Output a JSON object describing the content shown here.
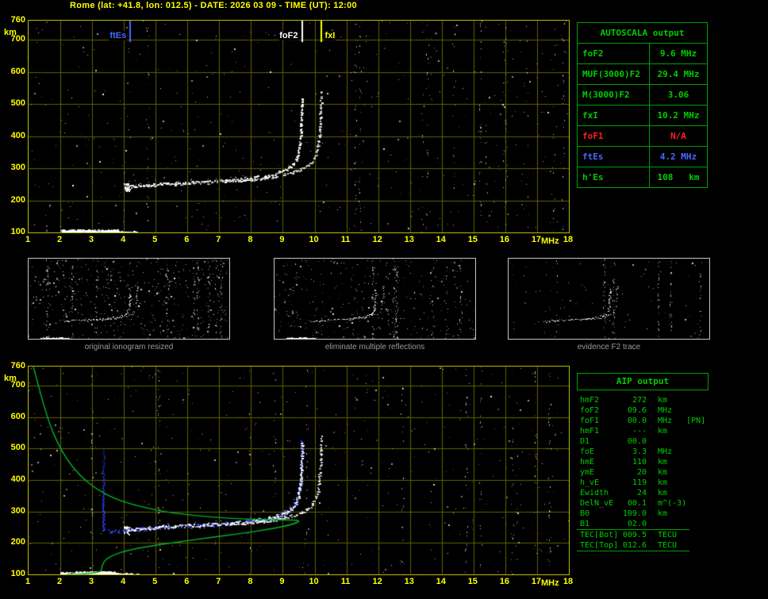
{
  "title": "Rome (lat: +41.8, lon: 012.5) - DATE: 2026 03 09 - TIME (UT): 12:00",
  "colors": {
    "axis": "#ffff00",
    "grid": "#616100",
    "plot_border": "#b9b900",
    "green_text": "#00cc00",
    "table_border": "#00a000",
    "red": "#ff2020",
    "blue": "#4868ff",
    "profile_green": "#00b428",
    "trace_blue": "#2e46ff",
    "caption_gray": "#9a9a9a"
  },
  "ionogram_axes": {
    "x_label": "MHz",
    "y_label": "km",
    "x_min": 1,
    "x_max": 18,
    "y_min": 100,
    "y_max": 760,
    "x_ticks": [
      1,
      2,
      3,
      4,
      5,
      6,
      7,
      8,
      9,
      10,
      11,
      12,
      13,
      14,
      15,
      16,
      17,
      18
    ],
    "y_ticks": [
      760,
      700,
      600,
      500,
      400,
      300,
      200,
      100
    ]
  },
  "top_plot_markers": [
    {
      "label": "ftEs",
      "freq": 4.2,
      "color": "#4868ff",
      "side": "left"
    },
    {
      "label": "foF2",
      "freq": 9.6,
      "color": "#ffffff",
      "side": "left"
    },
    {
      "label": "fxI",
      "freq": 10.2,
      "color": "#ffff00",
      "side": "right"
    }
  ],
  "autoscala_table": {
    "title": "AUTOSCALA output",
    "rows": [
      {
        "param": "foF2",
        "value": "9.6 MHz",
        "color": "green"
      },
      {
        "param": "MUF(3000)F2",
        "value": "29.4 MHz",
        "color": "green"
      },
      {
        "param": "M(3000)F2",
        "value": "3.06",
        "color": "green"
      },
      {
        "param": "fxI",
        "value": "10.2 MHz",
        "color": "green"
      },
      {
        "param": "foF1",
        "value": "N/A",
        "color": "red"
      },
      {
        "param": "ftEs",
        "value": "4.2 MHz",
        "color": "blue"
      },
      {
        "param": "h'Es",
        "value": "108   km",
        "color": "green"
      }
    ]
  },
  "thumbnails": [
    {
      "caption": "original ionogram resized"
    },
    {
      "caption": "eliminate multiple reflections"
    },
    {
      "caption": "evidence F2 trace"
    }
  ],
  "aip_table": {
    "title": "AIP output",
    "rows": [
      {
        "param": "hmF2",
        "value": "272",
        "unit": "km"
      },
      {
        "param": "foF2",
        "value": "09.6",
        "unit": "MHz"
      },
      {
        "param": "foF1",
        "value": "00.0",
        "unit": "MHz   [PN]"
      },
      {
        "param": "hmF1",
        "value": "---",
        "unit": "km"
      },
      {
        "param": "D1",
        "value": "00.0",
        "unit": ""
      },
      {
        "param": "foE",
        "value": "3.3",
        "unit": "MHz"
      },
      {
        "param": "hmE",
        "value": "110",
        "unit": "km"
      },
      {
        "param": "ymE",
        "value": "20",
        "unit": "km"
      },
      {
        "param": "h_vE",
        "value": "119",
        "unit": "km"
      },
      {
        "param": "Ewidth",
        "value": "24",
        "unit": "km"
      },
      {
        "param": "DelN_vE",
        "value": "00.1",
        "unit": "m^(-3)"
      },
      {
        "param": "B0",
        "value": "109.0",
        "unit": "km"
      },
      {
        "param": "B1",
        "value": "02.0",
        "unit": ""
      },
      {
        "param": "TEC[Bot]",
        "value": "009.5",
        "unit": "TECU",
        "section": "tec"
      },
      {
        "param": "TEC[Top]",
        "value": "012.6",
        "unit": "TECU",
        "section": "tec"
      }
    ]
  },
  "chart_data": [
    {
      "type": "scatter",
      "name": "scaled ionogram (top panel)",
      "xlabel": "MHz",
      "ylabel": "km",
      "xlim": [
        1,
        18
      ],
      "ylim": [
        100,
        760
      ],
      "foF2_MHz": 9.6,
      "fxI_MHz": 10.2,
      "ftEs_MHz": 4.2,
      "hEs_km": 108,
      "es_layer": {
        "f_range": [
          2.0,
          3.8
        ],
        "h_mean": 104,
        "h_spread": 6
      },
      "es_tail": {
        "f_range": [
          3.8,
          4.45
        ],
        "h_mean": 101,
        "h_spread": 2.5
      },
      "cusp": {
        "f_range": [
          3.98,
          4.18
        ],
        "h_range": [
          228,
          254
        ]
      },
      "o_trace": [
        [
          4.05,
          240
        ],
        [
          4.3,
          244
        ],
        [
          4.7,
          247
        ],
        [
          5.1,
          250
        ],
        [
          5.5,
          252
        ],
        [
          6.0,
          255
        ],
        [
          6.5,
          257
        ],
        [
          7.0,
          260
        ],
        [
          7.5,
          263
        ],
        [
          8.0,
          268
        ],
        [
          8.4,
          274
        ],
        [
          8.8,
          283
        ],
        [
          9.1,
          295
        ],
        [
          9.3,
          310
        ],
        [
          9.42,
          330
        ],
        [
          9.5,
          358
        ],
        [
          9.55,
          395
        ],
        [
          9.58,
          440
        ],
        [
          9.6,
          520
        ]
      ],
      "x_trace": [
        [
          7.2,
          259
        ],
        [
          7.7,
          262
        ],
        [
          8.2,
          266
        ],
        [
          8.7,
          272
        ],
        [
          9.1,
          280
        ],
        [
          9.4,
          290
        ],
        [
          9.7,
          302
        ],
        [
          9.9,
          318
        ],
        [
          10.02,
          340
        ],
        [
          10.1,
          368
        ],
        [
          10.15,
          405
        ],
        [
          10.18,
          455
        ],
        [
          10.2,
          540
        ]
      ]
    },
    {
      "type": "line",
      "name": "restored electron density profile (bottom panel)",
      "profile_green": [
        [
          1.15,
          760
        ],
        [
          1.4,
          665
        ],
        [
          1.65,
          580
        ],
        [
          1.9,
          520
        ],
        [
          2.2,
          465
        ],
        [
          2.6,
          415
        ],
        [
          3.1,
          373
        ],
        [
          3.7,
          340
        ],
        [
          4.5,
          315
        ],
        [
          5.5,
          295
        ],
        [
          6.8,
          281
        ],
        [
          8.0,
          275
        ],
        [
          9.0,
          273
        ],
        [
          9.6,
          272
        ],
        [
          9.3,
          258
        ],
        [
          8.6,
          244
        ],
        [
          7.7,
          230
        ],
        [
          6.7,
          217
        ],
        [
          5.7,
          203
        ],
        [
          4.8,
          190
        ],
        [
          4.1,
          176
        ],
        [
          3.7,
          163
        ],
        [
          3.45,
          150
        ],
        [
          3.35,
          136
        ],
        [
          3.3,
          122
        ],
        [
          3.3,
          112
        ],
        [
          3.2,
          107
        ],
        [
          2.9,
          103
        ],
        [
          2.5,
          100
        ],
        [
          2.2,
          100
        ]
      ],
      "restored_trace_blue": [
        [
          3.5,
          238
        ],
        [
          3.8,
          236
        ],
        [
          4.2,
          240
        ],
        [
          4.7,
          245
        ],
        [
          5.2,
          249
        ],
        [
          5.7,
          252
        ],
        [
          6.2,
          255
        ],
        [
          6.7,
          258
        ],
        [
          7.2,
          261
        ],
        [
          7.7,
          265
        ],
        [
          8.1,
          270
        ],
        [
          8.5,
          276
        ],
        [
          8.9,
          286
        ],
        [
          9.2,
          300
        ],
        [
          9.38,
          320
        ],
        [
          9.48,
          348
        ],
        [
          9.54,
          385
        ],
        [
          9.58,
          435
        ],
        [
          9.6,
          490
        ],
        [
          9.61,
          528
        ]
      ],
      "valley_asymptote_blue": {
        "f": 3.35,
        "h_range": [
          240,
          500
        ]
      }
    }
  ]
}
